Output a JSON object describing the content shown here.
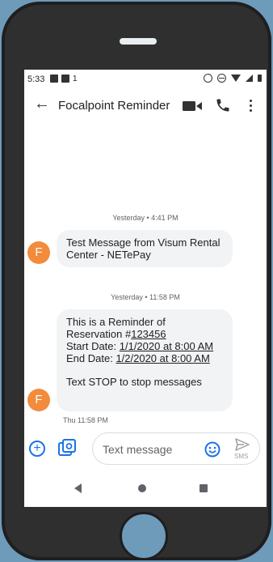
{
  "status_bar": {
    "time": "5:33",
    "badge": "1"
  },
  "header": {
    "contact_name": "Focalpoint Reminder"
  },
  "conversation": {
    "group1": {
      "timestamp": "Yesterday • 4:41 PM",
      "message": "Test Message from Visum Rental Center - NETePay",
      "avatar_letter": "F"
    },
    "group2": {
      "timestamp": "Yesterday • 11:58 PM",
      "line1": "This is a Reminder of",
      "line2_prefix": "Reservation #",
      "reservation_number": "123456",
      "start_prefix": "Start Date: ",
      "start_value": "1/1/2020 at 8:00 AM",
      "end_prefix": "End Date: ",
      "end_value": "1/2/2020 at 8:00 AM",
      "stop_line": "Text STOP to stop messages",
      "avatar_letter": "F",
      "time_below": "Thu 11:58 PM"
    }
  },
  "compose": {
    "placeholder": "Text message",
    "send_label": "SMS"
  },
  "colors": {
    "accent": "#1a73e8",
    "avatar": "#f28b3c",
    "bubble": "#f1f3f4",
    "background": "#6f9bbb"
  }
}
